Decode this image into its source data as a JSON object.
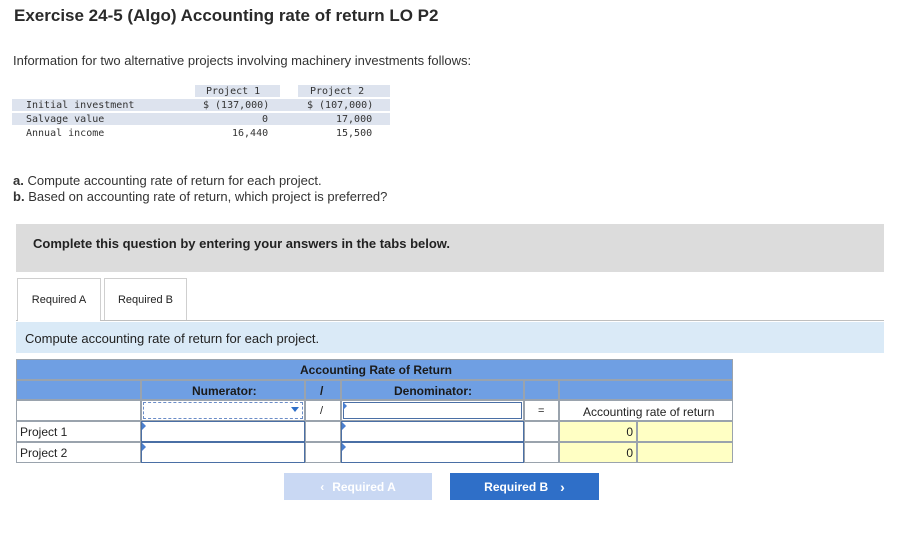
{
  "page": {
    "title": "Exercise 24-5 (Algo) Accounting rate of return LO P2",
    "intro": "Information for two alternative projects involving machinery investments follows:"
  },
  "info_table": {
    "headers": [
      "Project 1",
      "Project 2"
    ],
    "rows": [
      {
        "label": "Initial investment",
        "p1": "$ (137,000)",
        "p2": "$ (107,000)"
      },
      {
        "label": "Salvage value",
        "p1": "0",
        "p2": "17,000"
      },
      {
        "label": "Annual income",
        "p1": "16,440",
        "p2": "15,500"
      }
    ]
  },
  "questions": {
    "a_letter": "a.",
    "a_text": "Compute accounting rate of return for each project.",
    "b_letter": "b.",
    "b_text": "Based on accounting rate of return, which project is preferred?"
  },
  "banner": "Complete this question by entering your answers in the tabs below.",
  "tabs": [
    "Required A",
    "Required B"
  ],
  "instruction": "Compute accounting rate of return for each project.",
  "answer_table": {
    "title": "Accounting Rate of Return",
    "numerator_label": "Numerator:",
    "slash": "/",
    "denominator_label": "Denominator:",
    "equals": "=",
    "result_label": "Accounting rate of return",
    "rows": [
      {
        "label": "Project 1",
        "result": "0"
      },
      {
        "label": "Project 2",
        "result": "0"
      }
    ]
  },
  "nav": {
    "prev_label": "Required A",
    "prev_icon": "chevron-left-icon",
    "next_label": "Required B",
    "next_icon": "chevron-right-icon",
    "prev_color": "#c9d8f3",
    "next_color": "#2f6fc8"
  }
}
